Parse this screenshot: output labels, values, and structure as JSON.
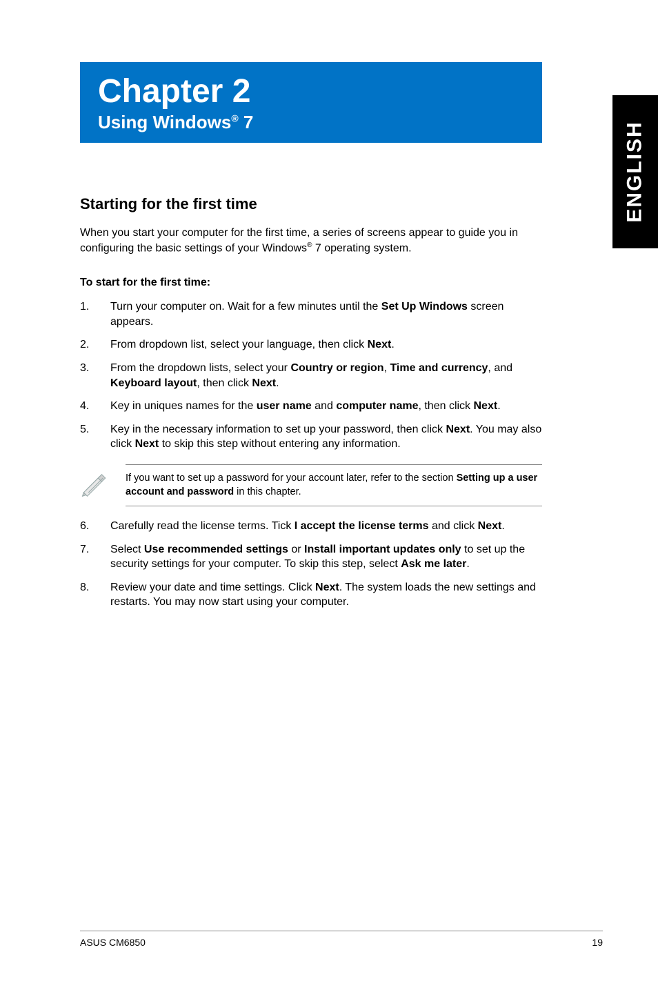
{
  "side_tab": "ENGLISH",
  "chapter": {
    "title": "Chapter 2",
    "subtitle_pre": "Using Windows",
    "subtitle_reg": "®",
    "subtitle_post": " 7"
  },
  "section": {
    "heading": "Starting for the first time",
    "intro_a": "When you start your computer for the first time, a series of screens appear to guide you in configuring the basic settings of your Windows",
    "intro_reg": "®",
    "intro_b": " 7 operating system.",
    "subhead": "To start for the first time:",
    "steps_a": [
      {
        "n": "1.",
        "parts": [
          "Turn your computer on. Wait for a few minutes until the ",
          {
            "b": "Set Up Windows"
          },
          " screen appears."
        ]
      },
      {
        "n": "2.",
        "parts": [
          "From dropdown list, select your language, then click ",
          {
            "b": "Next"
          },
          "."
        ]
      },
      {
        "n": "3.",
        "parts": [
          "From the dropdown lists, select your ",
          {
            "b": "Country or region"
          },
          ", ",
          {
            "b": "Time and currency"
          },
          ", and ",
          {
            "b": "Keyboard layout"
          },
          ", then click ",
          {
            "b": "Next"
          },
          "."
        ]
      },
      {
        "n": "4.",
        "parts": [
          "Key in uniques names for the ",
          {
            "b": "user name"
          },
          " and ",
          {
            "b": "computer name"
          },
          ", then click ",
          {
            "b": "Next"
          },
          "."
        ]
      },
      {
        "n": "5.",
        "parts": [
          "Key in the necessary information to set up your password, then click ",
          {
            "b": "Next"
          },
          ". You may also click ",
          {
            "b": "Next"
          },
          " to skip this step without entering any information."
        ]
      }
    ],
    "note": {
      "parts": [
        "If you want to set up a password for your account later, refer to the section ",
        {
          "b": "Setting up a user account and password"
        },
        " in this chapter."
      ]
    },
    "steps_b": [
      {
        "n": "6.",
        "parts": [
          "Carefully read the license terms. Tick ",
          {
            "b": "I accept the license terms"
          },
          " and click ",
          {
            "b": "Next"
          },
          "."
        ]
      },
      {
        "n": "7.",
        "parts": [
          "Select ",
          {
            "b": "Use recommended settings"
          },
          " or ",
          {
            "b": "Install important updates only"
          },
          " to set up the security settings for your computer. To skip this step, select ",
          {
            "b": "Ask me later"
          },
          "."
        ]
      },
      {
        "n": "8.",
        "parts": [
          "Review your date and time settings. Click ",
          {
            "b": "Next"
          },
          ". The system loads the new settings and restarts. You may now start using your computer."
        ]
      }
    ]
  },
  "footer": {
    "left": "ASUS CM6850",
    "right": "19"
  }
}
